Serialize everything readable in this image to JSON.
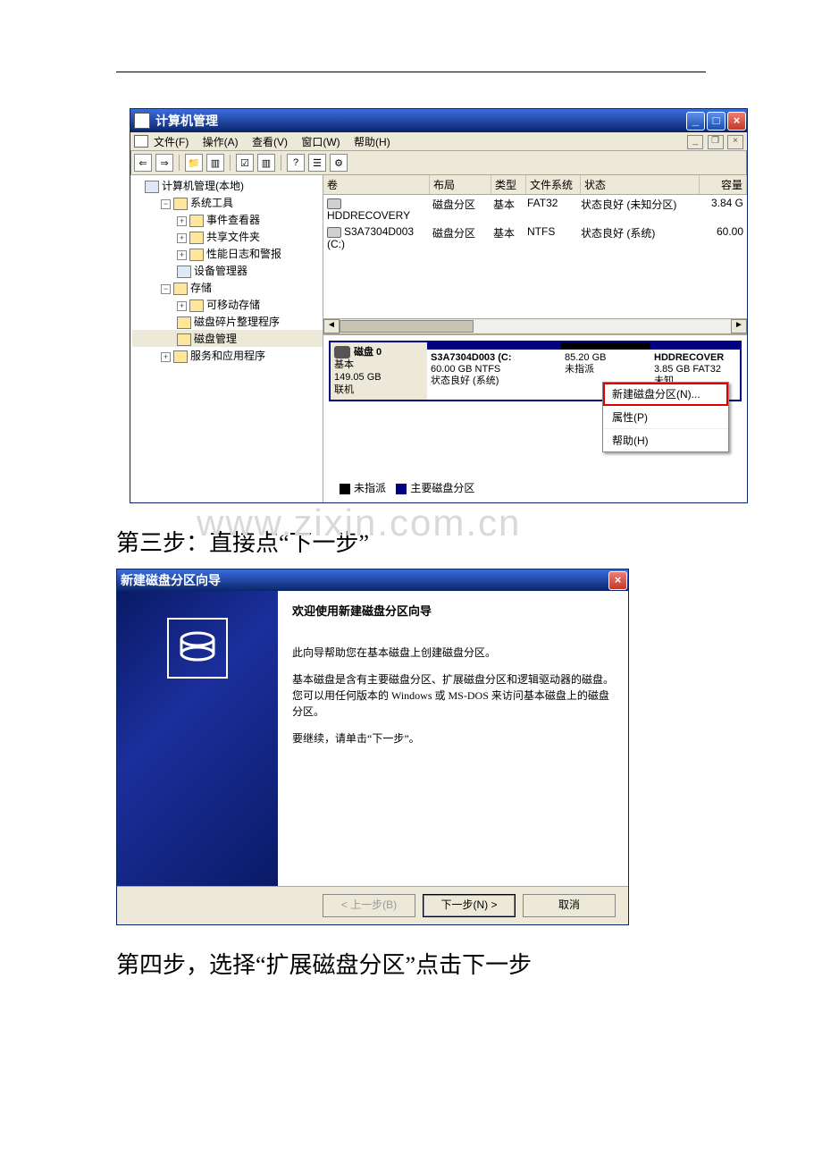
{
  "watermark": "www.zixin.com.cn",
  "compmgmt": {
    "title": "计算机管理",
    "menus": {
      "file": "文件(F)",
      "action": "操作(A)",
      "view": "查看(V)",
      "window": "窗口(W)",
      "help": "帮助(H)"
    },
    "tree": {
      "root": "计算机管理(本地)",
      "systools": "系统工具",
      "eventviewer": "事件查看器",
      "shared": "共享文件夹",
      "perf": "性能日志和警报",
      "devmgr": "设备管理器",
      "storage": "存储",
      "removable": "可移动存储",
      "defrag": "磁盘碎片整理程序",
      "diskmgmt": "磁盘管理",
      "services": "服务和应用程序"
    },
    "cols": {
      "vol": "卷",
      "layout": "布局",
      "type": "类型",
      "fs": "文件系统",
      "status": "状态",
      "cap": "容量"
    },
    "rows": [
      {
        "vol": "HDDRECOVERY",
        "layout": "磁盘分区",
        "type": "基本",
        "fs": "FAT32",
        "status": "状态良好 (未知分区)",
        "cap": "3.84 G"
      },
      {
        "vol": "S3A7304D003 (C:)",
        "layout": "磁盘分区",
        "type": "基本",
        "fs": "NTFS",
        "status": "状态良好 (系统)",
        "cap": "60.00"
      }
    ],
    "disk": {
      "label": "磁盘 0",
      "kind": "基本",
      "size": "149.05 GB",
      "state": "联机",
      "p1_name": "S3A7304D003 (C:",
      "p1_fs": "60.00 GB NTFS",
      "p1_status": "状态良好 (系统)",
      "p2_size": "85.20 GB",
      "p2_status": "未指派",
      "p3_name": "HDDRECOVER",
      "p3_fs": "3.85 GB FAT32",
      "p3_status": "未知"
    },
    "context": {
      "newpart": "新建磁盘分区(N)...",
      "props": "属性(P)",
      "help": "帮助(H)"
    },
    "legend": {
      "unalloc": "未指派",
      "primary": "主要磁盘分区"
    }
  },
  "step3": "第三步：直接点“下一步”",
  "wizard": {
    "title": "新建磁盘分区向导",
    "heading": "欢迎使用新建磁盘分区向导",
    "p1": "此向导帮助您在基本磁盘上创建磁盘分区。",
    "p2": "基本磁盘是含有主要磁盘分区、扩展磁盘分区和逻辑驱动器的磁盘。您可以用任何版本的 Windows 或 MS-DOS 来访问基本磁盘上的磁盘分区。",
    "p3": "要继续，请单击“下一步”。",
    "back": "< 上一步(B)",
    "next": "下一步(N) >",
    "cancel": "取消"
  },
  "step4": "第四步，选择“扩展磁盘分区”点击下一步"
}
